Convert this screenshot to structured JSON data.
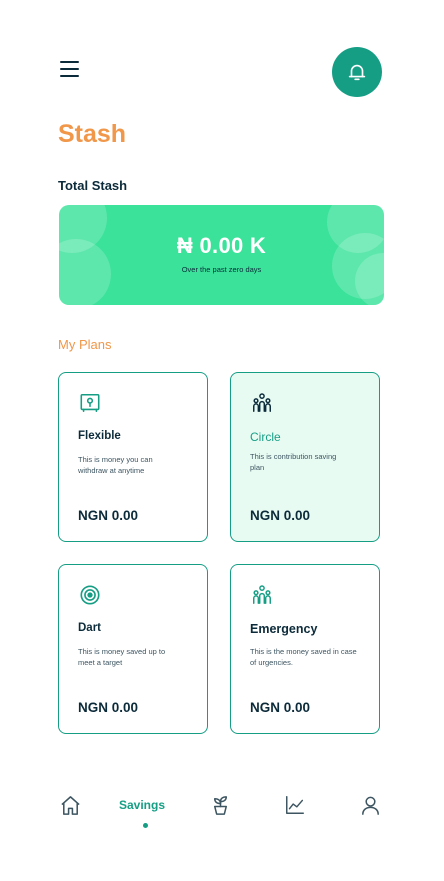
{
  "page": {
    "title": "Stash"
  },
  "summary": {
    "label": "Total Stash",
    "amount": "₦ 0.00 K",
    "period": "Over the past zero days"
  },
  "plans": {
    "label": "My Plans",
    "items": [
      {
        "icon": "safe-icon",
        "name": "Flexible",
        "description": "This is money you can withdraw at anytime",
        "amount": "NGN 0.00",
        "selected": false
      },
      {
        "icon": "group-icon",
        "name": "Circle",
        "description": "This is contribution saving plan",
        "amount": "NGN 0.00",
        "selected": true
      },
      {
        "icon": "target-icon",
        "name": "Dart",
        "description": "This is money saved up to meet a target",
        "amount": "NGN 0.00",
        "selected": false
      },
      {
        "icon": "group-icon",
        "name": "Emergency",
        "description": "This is the money saved in case of urgencies.",
        "amount": "NGN 0.00",
        "selected": false
      }
    ]
  },
  "nav": {
    "active": "Savings",
    "items": [
      {
        "icon": "home-icon"
      },
      {
        "label": "Savings"
      },
      {
        "icon": "plant-icon"
      },
      {
        "icon": "chart-icon"
      },
      {
        "icon": "profile-icon"
      }
    ]
  },
  "colors": {
    "accent": "#169e85",
    "brand_orange": "#f0974a",
    "card_green": "#3ae29a",
    "selected_card_bg": "#e8fbf3",
    "text_dark": "#0c2b3a"
  }
}
